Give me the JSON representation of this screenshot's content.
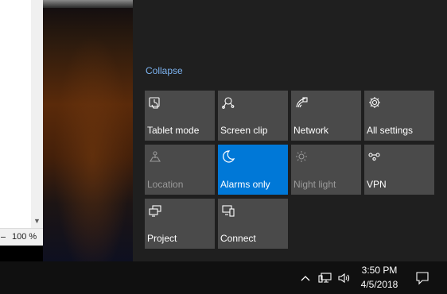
{
  "document": {
    "zoom_label": "100 %"
  },
  "action_center": {
    "collapse_label": "Collapse",
    "accent_color": "#0078d7",
    "tiles": [
      {
        "label": "Tablet mode",
        "icon": "tablet-mode-icon",
        "state": "off"
      },
      {
        "label": "Screen clip",
        "icon": "screen-clip-icon",
        "state": "off"
      },
      {
        "label": "Network",
        "icon": "network-icon",
        "state": "off"
      },
      {
        "label": "All settings",
        "icon": "gear-icon",
        "state": "off"
      },
      {
        "label": "Location",
        "icon": "location-icon",
        "state": "disabled"
      },
      {
        "label": "Alarms only",
        "icon": "moon-icon",
        "state": "on"
      },
      {
        "label": "Night light",
        "icon": "sun-icon",
        "state": "disabled"
      },
      {
        "label": "VPN",
        "icon": "vpn-icon",
        "state": "off"
      },
      {
        "label": "Project",
        "icon": "project-icon",
        "state": "off"
      },
      {
        "label": "Connect",
        "icon": "connect-icon",
        "state": "off"
      }
    ]
  },
  "taskbar": {
    "time": "3:50 PM",
    "date": "4/5/2018",
    "tray_icons": [
      "chevron-up-icon",
      "network-monitor-icon",
      "speaker-icon",
      "notification-icon"
    ]
  }
}
